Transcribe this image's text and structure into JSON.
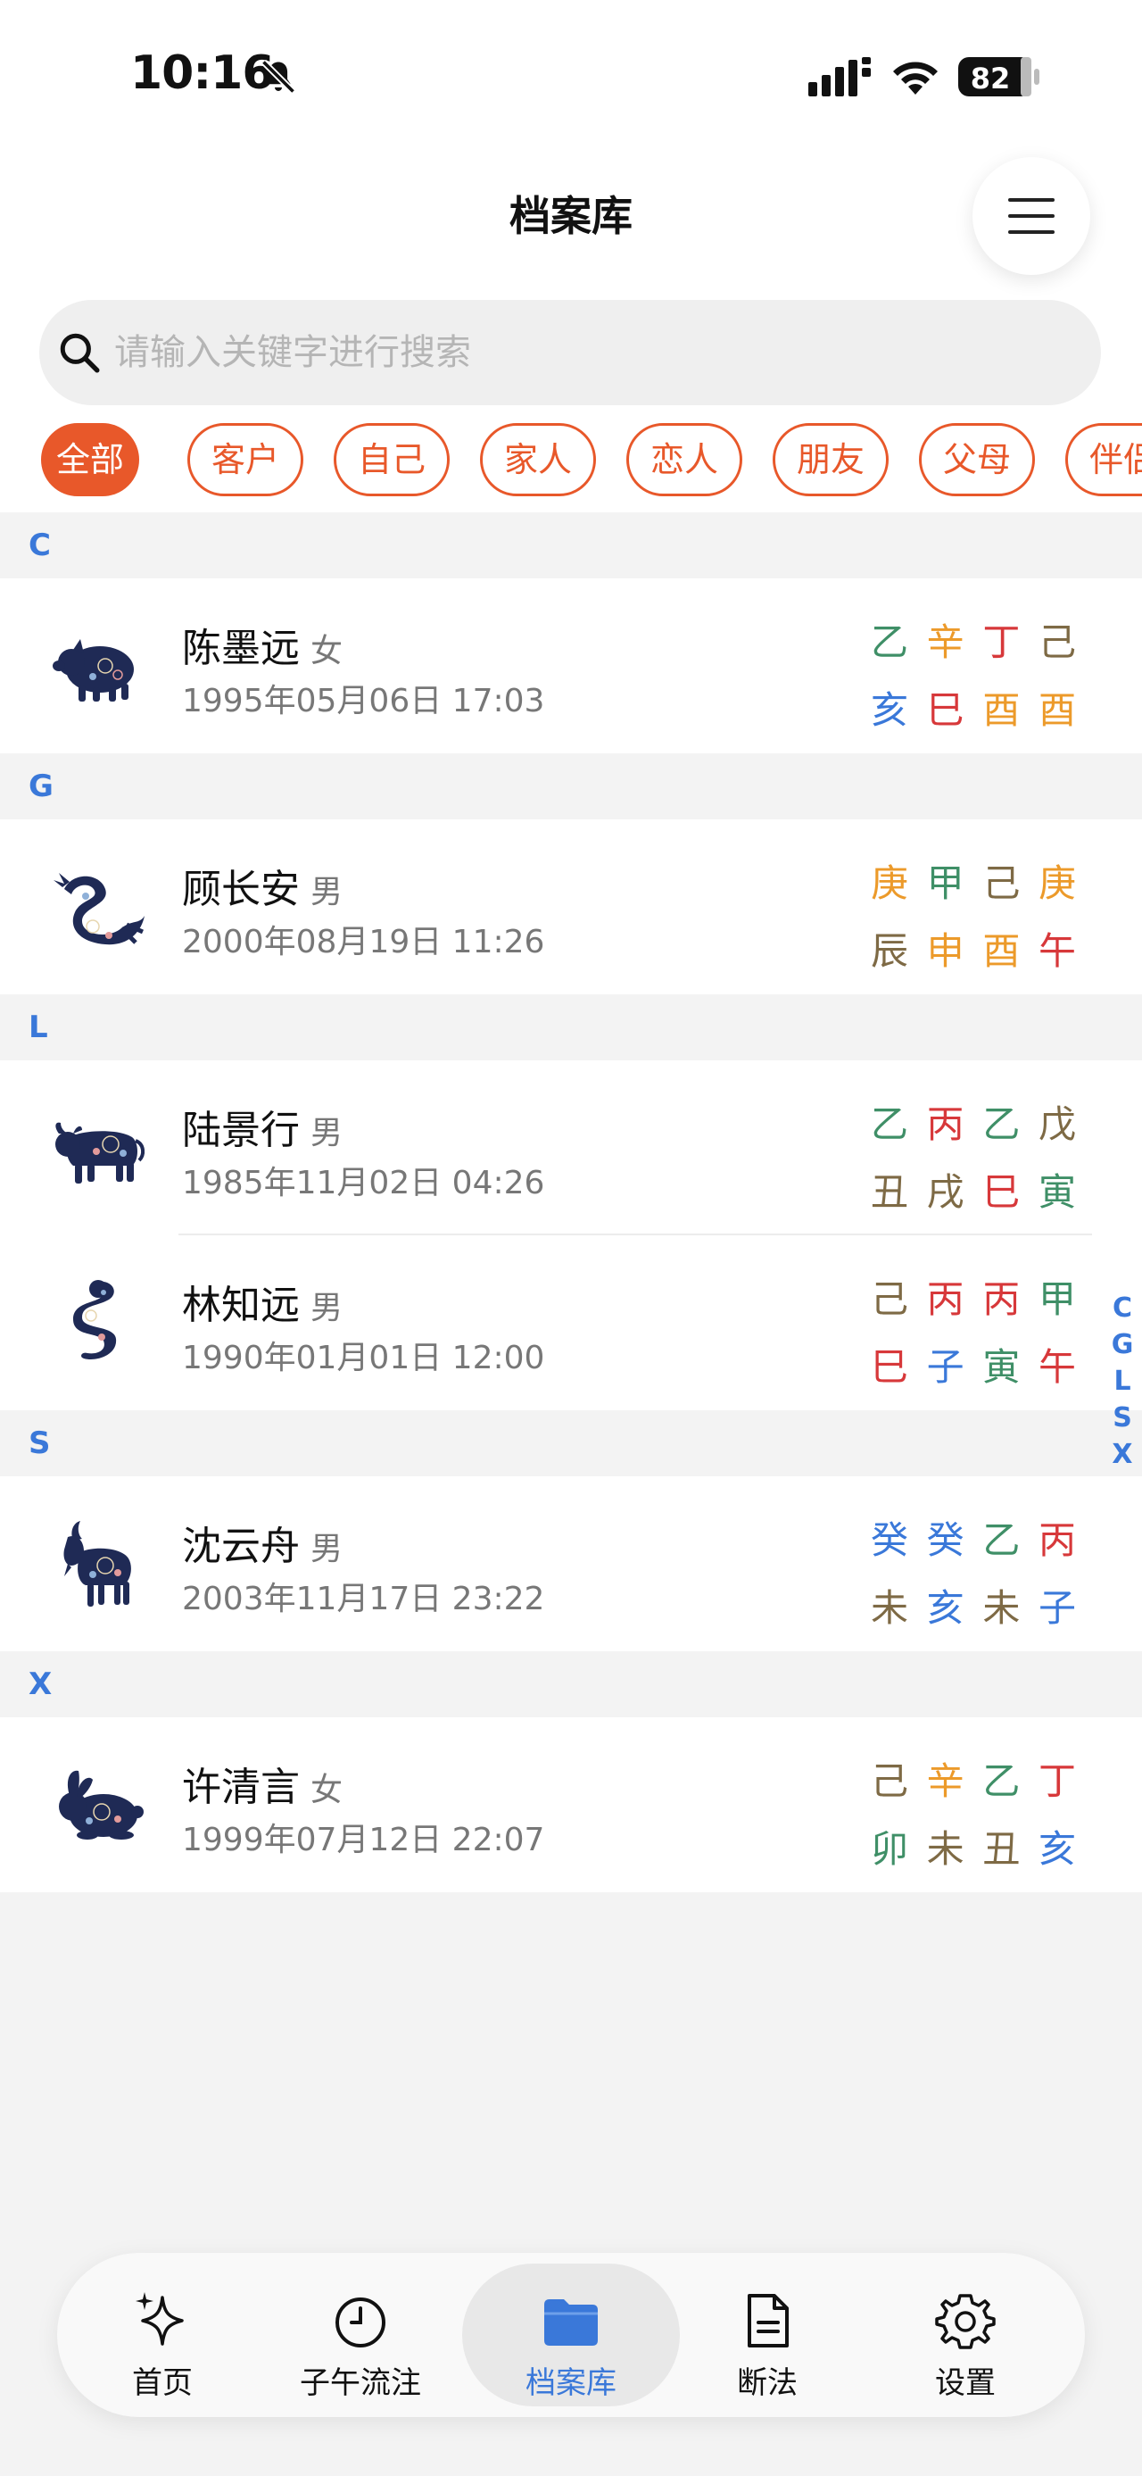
{
  "status_bar": {
    "time": "10:16",
    "battery": "82"
  },
  "header": {
    "title": "档案库"
  },
  "search": {
    "placeholder": "请输入关键字进行搜索"
  },
  "filters": [
    "全部",
    "客户",
    "自己",
    "家人",
    "恋人",
    "朋友",
    "父母",
    "伴侣"
  ],
  "filter_active": "全部",
  "sections": [
    {
      "letter": "C",
      "people": [
        {
          "name": "陈墨远",
          "gender": "女",
          "birth": "1995年05月06日 17:03",
          "zodiac": "pig",
          "stems": [
            {
              "c": "乙",
              "e": "wood"
            },
            {
              "c": "辛",
              "e": "metal"
            },
            {
              "c": "丁",
              "e": "fire"
            },
            {
              "c": "己",
              "e": "earth"
            }
          ],
          "branches": [
            {
              "c": "亥",
              "e": "water"
            },
            {
              "c": "巳",
              "e": "fire"
            },
            {
              "c": "酉",
              "e": "metal"
            },
            {
              "c": "酉",
              "e": "metal"
            }
          ]
        }
      ]
    },
    {
      "letter": "G",
      "people": [
        {
          "name": "顾长安",
          "gender": "男",
          "birth": "2000年08月19日 11:26",
          "zodiac": "dragon",
          "stems": [
            {
              "c": "庚",
              "e": "metal"
            },
            {
              "c": "甲",
              "e": "wood"
            },
            {
              "c": "己",
              "e": "earth"
            },
            {
              "c": "庚",
              "e": "metal"
            }
          ],
          "branches": [
            {
              "c": "辰",
              "e": "earth"
            },
            {
              "c": "申",
              "e": "metal"
            },
            {
              "c": "酉",
              "e": "metal"
            },
            {
              "c": "午",
              "e": "fire"
            }
          ]
        }
      ]
    },
    {
      "letter": "L",
      "people": [
        {
          "name": "陆景行",
          "gender": "男",
          "birth": "1985年11月02日 04:26",
          "zodiac": "ox",
          "stems": [
            {
              "c": "乙",
              "e": "wood"
            },
            {
              "c": "丙",
              "e": "fire"
            },
            {
              "c": "乙",
              "e": "wood"
            },
            {
              "c": "戊",
              "e": "earth"
            }
          ],
          "branches": [
            {
              "c": "丑",
              "e": "earth"
            },
            {
              "c": "戌",
              "e": "earth"
            },
            {
              "c": "巳",
              "e": "fire"
            },
            {
              "c": "寅",
              "e": "wood"
            }
          ]
        },
        {
          "name": "林知远",
          "gender": "男",
          "birth": "1990年01月01日 12:00",
          "zodiac": "snake",
          "stems": [
            {
              "c": "己",
              "e": "earth"
            },
            {
              "c": "丙",
              "e": "fire"
            },
            {
              "c": "丙",
              "e": "fire"
            },
            {
              "c": "甲",
              "e": "wood"
            }
          ],
          "branches": [
            {
              "c": "巳",
              "e": "fire"
            },
            {
              "c": "子",
              "e": "water"
            },
            {
              "c": "寅",
              "e": "wood"
            },
            {
              "c": "午",
              "e": "fire"
            }
          ]
        }
      ]
    },
    {
      "letter": "S",
      "people": [
        {
          "name": "沈云舟",
          "gender": "男",
          "birth": "2003年11月17日 23:22",
          "zodiac": "goat",
          "stems": [
            {
              "c": "癸",
              "e": "water"
            },
            {
              "c": "癸",
              "e": "water"
            },
            {
              "c": "乙",
              "e": "wood"
            },
            {
              "c": "丙",
              "e": "fire"
            }
          ],
          "branches": [
            {
              "c": "未",
              "e": "earth"
            },
            {
              "c": "亥",
              "e": "water"
            },
            {
              "c": "未",
              "e": "earth"
            },
            {
              "c": "子",
              "e": "water"
            }
          ]
        }
      ]
    },
    {
      "letter": "X",
      "people": [
        {
          "name": "许清言",
          "gender": "女",
          "birth": "1999年07月12日 22:07",
          "zodiac": "rabbit",
          "stems": [
            {
              "c": "己",
              "e": "earth"
            },
            {
              "c": "辛",
              "e": "metal"
            },
            {
              "c": "乙",
              "e": "wood"
            },
            {
              "c": "丁",
              "e": "fire"
            }
          ],
          "branches": [
            {
              "c": "卯",
              "e": "wood"
            },
            {
              "c": "未",
              "e": "earth"
            },
            {
              "c": "丑",
              "e": "earth"
            },
            {
              "c": "亥",
              "e": "water"
            }
          ]
        }
      ]
    }
  ],
  "alpha_index": [
    "C",
    "G",
    "L",
    "S",
    "X"
  ],
  "nav": [
    {
      "label": "首页",
      "icon": "sparkle-icon"
    },
    {
      "label": "子午流注",
      "icon": "clock-icon"
    },
    {
      "label": "档案库",
      "icon": "folder-icon",
      "active": true
    },
    {
      "label": "断法",
      "icon": "document-icon"
    },
    {
      "label": "设置",
      "icon": "gear-icon"
    }
  ],
  "colors": {
    "accent": "#e8582a",
    "link_blue": "#3a78d9",
    "wood": "#3f8f67",
    "fire": "#d7383a",
    "earth": "#7e6a45",
    "metal": "#ec9a2a",
    "water": "#3a78d9"
  }
}
